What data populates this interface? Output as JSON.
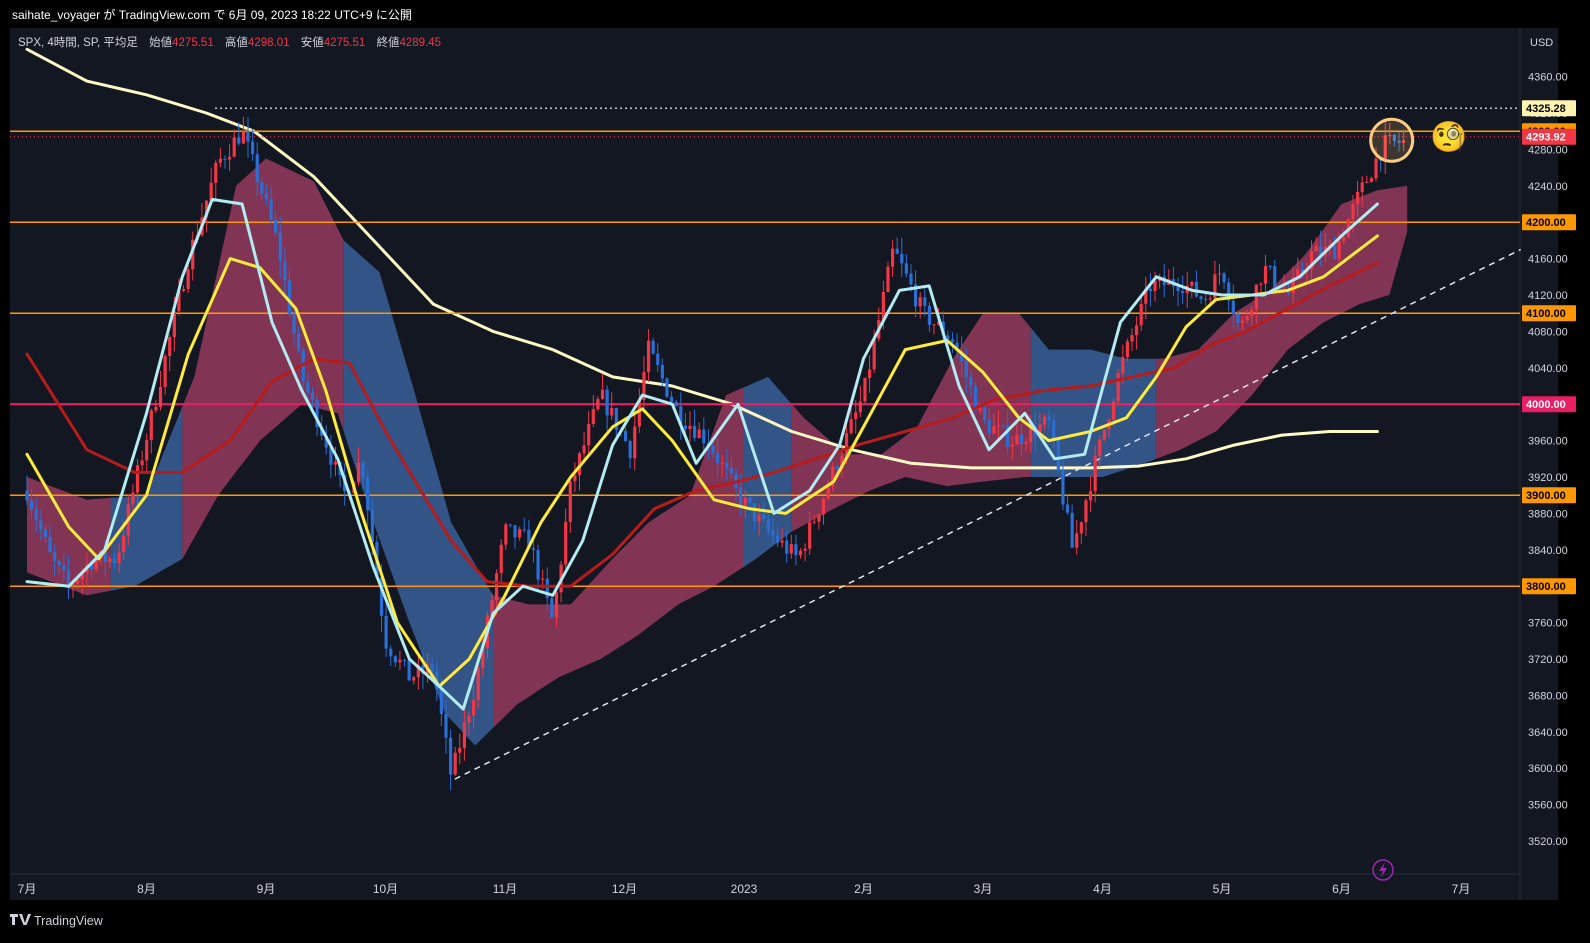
{
  "header": {
    "publish_line": "saihate_voyager が TradingView.com で 6月 09, 2023 18:22 UTC+9 に公開"
  },
  "legend": {
    "symbol": "SPX, 4時間, SP, 平均足",
    "open_label": "始値",
    "open_value": "4275.51",
    "high_label": "高値",
    "high_value": "4298.01",
    "low_label": "安値",
    "low_value": "4275.51",
    "close_label": "終値",
    "close_value": "4289.45"
  },
  "footer": {
    "brand": "TradingView"
  },
  "colors": {
    "background": "#131722",
    "frame": "#000000",
    "text": "#d1d4dc",
    "up": "#f23645",
    "down": "#2a6fd6",
    "orange": "#ff9800",
    "magenta": "#e91e63",
    "ma_short": "#b2ebf2",
    "ma_mid": "#ffeb3b",
    "ma_long": "#b71c1c",
    "ma_200": "#fff9c4",
    "cloud_bear": "#b0426a",
    "cloud_bull": "#3d6aa8"
  },
  "chart_data": {
    "type": "candlestick",
    "title": "SPX, 4時間, SP, 平均足",
    "currency": "USD",
    "ylim": [
      3500,
      4390
    ],
    "y_ticks": [
      "4360.00",
      "4320.00",
      "4280.00",
      "4240.00",
      "4200.00",
      "4160.00",
      "4120.00",
      "4080.00",
      "4040.00",
      "4000.00",
      "3960.00",
      "3920.00",
      "3880.00",
      "3840.00",
      "3800.00",
      "3760.00",
      "3720.00",
      "3680.00",
      "3640.00",
      "3600.00",
      "3560.00",
      "3520.00"
    ],
    "x_ticks": [
      "7月",
      "8月",
      "9月",
      "10月",
      "11月",
      "12月",
      "2023",
      "2月",
      "3月",
      "4月",
      "5月",
      "6月",
      "7月"
    ],
    "x_tick_months": [
      0,
      1,
      2,
      3,
      4,
      5,
      6,
      7,
      8,
      9,
      10,
      11,
      12
    ],
    "horizontal_levels": [
      {
        "value": 4300,
        "label": "4300.00",
        "color": "#ff9800"
      },
      {
        "value": 4200,
        "label": "4200.00",
        "color": "#ff9800"
      },
      {
        "value": 4100,
        "label": "4100.00",
        "color": "#ff9800"
      },
      {
        "value": 4000,
        "label": "4000.00",
        "color": "#e91e63"
      },
      {
        "value": 3900,
        "label": "3900.00",
        "color": "#ff9800"
      },
      {
        "value": 3800,
        "label": "3800.00",
        "color": "#ff9800"
      }
    ],
    "dotted_level": {
      "value": 4325.28,
      "label": "4325.28"
    },
    "last_price": {
      "value": 4293.92,
      "label": "4293.92"
    },
    "trendline": {
      "from": [
        3.58,
        3588
      ],
      "to": [
        12.5,
        4170
      ]
    },
    "ma_series": [
      {
        "key": "ma_short",
        "points": [
          [
            0,
            3805
          ],
          [
            0.35,
            3800
          ],
          [
            0.65,
            3840
          ],
          [
            1.0,
            3990
          ],
          [
            1.3,
            4140
          ],
          [
            1.55,
            4225
          ],
          [
            1.8,
            4220
          ],
          [
            2.05,
            4090
          ],
          [
            2.3,
            4015
          ],
          [
            2.6,
            3940
          ],
          [
            2.9,
            3820
          ],
          [
            3.2,
            3720
          ],
          [
            3.45,
            3690
          ],
          [
            3.65,
            3665
          ],
          [
            3.9,
            3770
          ],
          [
            4.15,
            3800
          ],
          [
            4.4,
            3790
          ],
          [
            4.65,
            3850
          ],
          [
            4.9,
            3955
          ],
          [
            5.15,
            4010
          ],
          [
            5.4,
            4000
          ],
          [
            5.6,
            3935
          ],
          [
            5.95,
            4000
          ],
          [
            6.25,
            3880
          ],
          [
            6.55,
            3905
          ],
          [
            6.8,
            3955
          ],
          [
            7.0,
            4050
          ],
          [
            7.3,
            4125
          ],
          [
            7.55,
            4130
          ],
          [
            7.8,
            4020
          ],
          [
            8.05,
            3950
          ],
          [
            8.35,
            3990
          ],
          [
            8.6,
            3940
          ],
          [
            8.85,
            3945
          ],
          [
            9.15,
            4090
          ],
          [
            9.45,
            4140
          ],
          [
            9.75,
            4125
          ],
          [
            10.0,
            4120
          ],
          [
            10.35,
            4120
          ],
          [
            10.65,
            4140
          ],
          [
            11.0,
            4185
          ],
          [
            11.3,
            4220
          ]
        ]
      },
      {
        "key": "ma_mid",
        "points": [
          [
            0,
            3945
          ],
          [
            0.35,
            3865
          ],
          [
            0.6,
            3830
          ],
          [
            1.0,
            3900
          ],
          [
            1.35,
            4055
          ],
          [
            1.7,
            4160
          ],
          [
            1.95,
            4150
          ],
          [
            2.25,
            4105
          ],
          [
            2.5,
            4015
          ],
          [
            2.8,
            3880
          ],
          [
            3.1,
            3760
          ],
          [
            3.45,
            3690
          ],
          [
            3.7,
            3720
          ],
          [
            4.0,
            3790
          ],
          [
            4.3,
            3870
          ],
          [
            4.55,
            3920
          ],
          [
            4.9,
            3975
          ],
          [
            5.15,
            3995
          ],
          [
            5.4,
            3960
          ],
          [
            5.75,
            3895
          ],
          [
            6.05,
            3885
          ],
          [
            6.35,
            3880
          ],
          [
            6.75,
            3915
          ],
          [
            7.0,
            3975
          ],
          [
            7.35,
            4060
          ],
          [
            7.7,
            4070
          ],
          [
            8.0,
            4035
          ],
          [
            8.3,
            3985
          ],
          [
            8.55,
            3960
          ],
          [
            8.9,
            3970
          ],
          [
            9.2,
            3985
          ],
          [
            9.45,
            4030
          ],
          [
            9.7,
            4085
          ],
          [
            9.95,
            4115
          ],
          [
            10.25,
            4120
          ],
          [
            10.55,
            4125
          ],
          [
            10.85,
            4140
          ],
          [
            11.3,
            4185
          ]
        ]
      },
      {
        "key": "ma_long",
        "points": [
          [
            0,
            4055
          ],
          [
            0.5,
            3950
          ],
          [
            0.9,
            3925
          ],
          [
            1.3,
            3925
          ],
          [
            1.7,
            3960
          ],
          [
            2.05,
            4025
          ],
          [
            2.4,
            4050
          ],
          [
            2.7,
            4045
          ],
          [
            3.0,
            3970
          ],
          [
            3.25,
            3915
          ],
          [
            3.55,
            3850
          ],
          [
            3.85,
            3805
          ],
          [
            4.2,
            3800
          ],
          [
            4.55,
            3800
          ],
          [
            4.9,
            3835
          ],
          [
            5.25,
            3885
          ],
          [
            5.6,
            3905
          ],
          [
            5.95,
            3915
          ],
          [
            6.25,
            3925
          ],
          [
            6.6,
            3940
          ],
          [
            6.95,
            3955
          ],
          [
            7.35,
            3970
          ],
          [
            7.75,
            3985
          ],
          [
            8.1,
            4005
          ],
          [
            8.5,
            4015
          ],
          [
            8.9,
            4020
          ],
          [
            9.25,
            4030
          ],
          [
            9.6,
            4040
          ],
          [
            9.9,
            4065
          ],
          [
            10.2,
            4080
          ],
          [
            10.55,
            4105
          ],
          [
            10.9,
            4130
          ],
          [
            11.3,
            4155
          ]
        ]
      },
      {
        "key": "ma_200",
        "points": [
          [
            0,
            4390
          ],
          [
            0.5,
            4355
          ],
          [
            1.0,
            4340
          ],
          [
            1.5,
            4320
          ],
          [
            1.9,
            4300
          ],
          [
            2.4,
            4250
          ],
          [
            2.9,
            4180
          ],
          [
            3.4,
            4110
          ],
          [
            3.9,
            4080
          ],
          [
            4.4,
            4060
          ],
          [
            4.9,
            4030
          ],
          [
            5.4,
            4020
          ],
          [
            5.9,
            4000
          ],
          [
            6.4,
            3970
          ],
          [
            6.9,
            3950
          ],
          [
            7.4,
            3935
          ],
          [
            7.9,
            3930
          ],
          [
            8.4,
            3930
          ],
          [
            8.9,
            3930
          ],
          [
            9.3,
            3932
          ],
          [
            9.7,
            3940
          ],
          [
            10.1,
            3955
          ],
          [
            10.5,
            3966
          ],
          [
            10.9,
            3970
          ],
          [
            11.3,
            3970
          ]
        ]
      }
    ],
    "cloud": {
      "upper": [
        [
          0,
          3920
        ],
        [
          0.5,
          3895
        ],
        [
          1.0,
          3900
        ],
        [
          1.4,
          4030
        ],
        [
          1.75,
          4240
        ],
        [
          2.0,
          4270
        ],
        [
          2.4,
          4245
        ],
        [
          2.65,
          4180
        ],
        [
          2.95,
          4145
        ],
        [
          3.25,
          4010
        ],
        [
          3.55,
          3870
        ],
        [
          3.9,
          3790
        ],
        [
          4.2,
          3780
        ],
        [
          4.55,
          3780
        ],
        [
          4.9,
          3830
        ],
        [
          5.2,
          3870
        ],
        [
          5.55,
          3900
        ],
        [
          5.85,
          4010
        ],
        [
          6.2,
          4030
        ],
        [
          6.5,
          3985
        ],
        [
          6.85,
          3945
        ],
        [
          7.15,
          3945
        ],
        [
          7.45,
          3975
        ],
        [
          7.75,
          4050
        ],
        [
          8.0,
          4100
        ],
        [
          8.3,
          4100
        ],
        [
          8.55,
          4060
        ],
        [
          8.9,
          4060
        ],
        [
          9.2,
          4050
        ],
        [
          9.5,
          4050
        ],
        [
          9.8,
          4060
        ],
        [
          10.1,
          4100
        ],
        [
          10.4,
          4125
        ],
        [
          10.7,
          4165
        ],
        [
          11.0,
          4220
        ],
        [
          11.3,
          4235
        ],
        [
          11.55,
          4240
        ]
      ],
      "lower": [
        [
          0,
          3815
        ],
        [
          0.5,
          3790
        ],
        [
          0.9,
          3800
        ],
        [
          1.3,
          3830
        ],
        [
          1.6,
          3900
        ],
        [
          1.95,
          3960
        ],
        [
          2.3,
          4000
        ],
        [
          2.6,
          3990
        ],
        [
          2.9,
          3870
        ],
        [
          3.2,
          3760
        ],
        [
          3.5,
          3660
        ],
        [
          3.75,
          3625
        ],
        [
          4.1,
          3670
        ],
        [
          4.45,
          3700
        ],
        [
          4.8,
          3720
        ],
        [
          5.1,
          3745
        ],
        [
          5.45,
          3780
        ],
        [
          5.75,
          3800
        ],
        [
          6.1,
          3830
        ],
        [
          6.4,
          3860
        ],
        [
          6.75,
          3885
        ],
        [
          7.05,
          3905
        ],
        [
          7.35,
          3920
        ],
        [
          7.7,
          3910
        ],
        [
          8.0,
          3915
        ],
        [
          8.35,
          3920
        ],
        [
          8.7,
          3920
        ],
        [
          9.0,
          3920
        ],
        [
          9.35,
          3935
        ],
        [
          9.65,
          3950
        ],
        [
          9.95,
          3970
        ],
        [
          10.25,
          4010
        ],
        [
          10.55,
          4060
        ],
        [
          10.85,
          4090
        ],
        [
          11.15,
          4110
        ],
        [
          11.4,
          4120
        ],
        [
          11.55,
          4190
        ]
      ],
      "bull_ranges": [
        [
          0.7,
          1.3
        ],
        [
          2.6,
          3.85
        ],
        [
          5.95,
          6.35
        ],
        [
          8.35,
          8.9
        ],
        [
          8.9,
          9.4
        ]
      ]
    },
    "candles_generator": {
      "anchors": [
        [
          0,
          3905
        ],
        [
          0.2,
          3830
        ],
        [
          0.35,
          3800
        ],
        [
          0.55,
          3830
        ],
        [
          0.75,
          3830
        ],
        [
          1.05,
          3990
        ],
        [
          1.35,
          4160
        ],
        [
          1.6,
          4265
        ],
        [
          1.8,
          4300
        ],
        [
          1.95,
          4240
        ],
        [
          2.1,
          4175
        ],
        [
          2.3,
          4030
        ],
        [
          2.5,
          3960
        ],
        [
          2.65,
          3900
        ],
        [
          2.8,
          3940
        ],
        [
          3.0,
          3740
        ],
        [
          3.2,
          3700
        ],
        [
          3.4,
          3710
        ],
        [
          3.55,
          3590
        ],
        [
          3.75,
          3690
        ],
        [
          4.0,
          3860
        ],
        [
          4.2,
          3850
        ],
        [
          4.4,
          3760
        ],
        [
          4.55,
          3910
        ],
        [
          4.8,
          4010
        ],
        [
          5.05,
          3950
        ],
        [
          5.2,
          4060
        ],
        [
          5.45,
          3990
        ],
        [
          5.7,
          3960
        ],
        [
          5.95,
          3900
        ],
        [
          6.2,
          3860
        ],
        [
          6.45,
          3830
        ],
        [
          6.7,
          3910
        ],
        [
          7.0,
          4010
        ],
        [
          7.25,
          4170
        ],
        [
          7.5,
          4100
        ],
        [
          7.75,
          4070
        ],
        [
          8.0,
          3980
        ],
        [
          8.25,
          3960
        ],
        [
          8.55,
          3980
        ],
        [
          8.75,
          3840
        ],
        [
          8.95,
          3940
        ],
        [
          9.15,
          4040
        ],
        [
          9.4,
          4130
        ],
        [
          9.65,
          4135
        ],
        [
          9.85,
          4115
        ],
        [
          10.0,
          4150
        ],
        [
          10.15,
          4080
        ],
        [
          10.35,
          4150
        ],
        [
          10.55,
          4120
        ],
        [
          10.75,
          4165
        ],
        [
          10.95,
          4170
        ],
        [
          11.15,
          4230
        ],
        [
          11.35,
          4285
        ],
        [
          11.5,
          4288
        ]
      ],
      "count": 300,
      "x_range": [
        0,
        11.52
      ]
    },
    "highlight_circle": {
      "x": 11.42,
      "y": 4290
    },
    "annotation_emoji": "🧐"
  }
}
